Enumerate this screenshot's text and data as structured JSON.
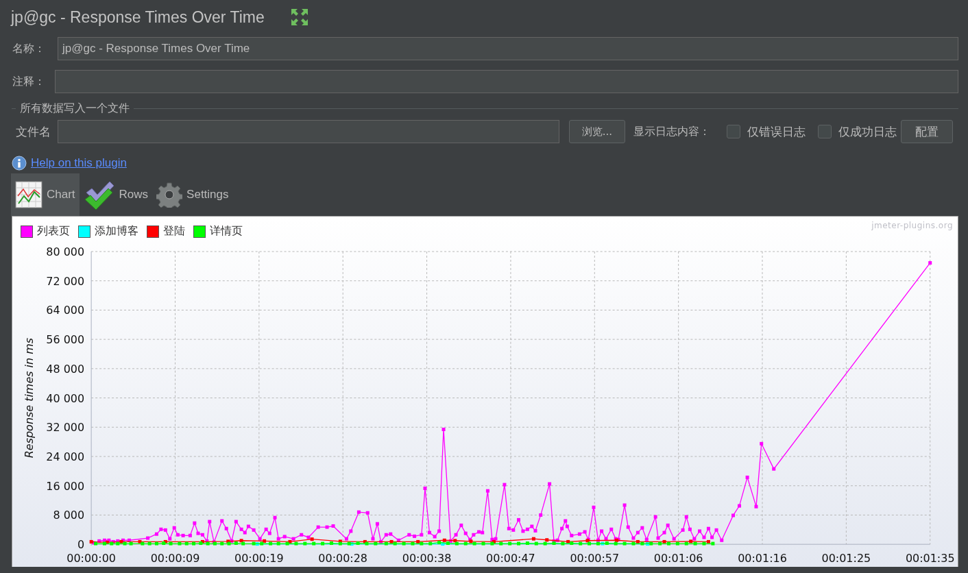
{
  "window": {
    "title": "jp@gc - Response Times Over Time"
  },
  "name_field": {
    "label": "名称：",
    "value": "jp@gc - Response Times Over Time"
  },
  "comment_field": {
    "label": "注释："
  },
  "file_section": {
    "title": "所有数据写入一个文件",
    "file_label": "文件名",
    "browse_button": "浏览...",
    "log_label": "显示日志内容：",
    "checkboxes": [
      {
        "label": "仅错误日志",
        "checked": false
      },
      {
        "label": "仅成功日志",
        "checked": false
      }
    ],
    "config_button": "配置"
  },
  "help_link": "Help on this plugin",
  "tabs": [
    {
      "label": "Chart",
      "kind": "chart",
      "selected": true
    },
    {
      "label": "Rows",
      "kind": "rows",
      "selected": false
    },
    {
      "label": "Settings",
      "kind": "settings",
      "selected": false
    }
  ],
  "chart": {
    "credit": "jmeter-plugins.org",
    "chart_data": {
      "type": "line",
      "grid": true,
      "ylabel": "Response times in ms",
      "xlim": [
        0,
        95
      ],
      "ylim": [
        0,
        80000
      ],
      "xticks": [
        {
          "value": 0,
          "label": "00:00:00"
        },
        {
          "value": 9.5,
          "label": "00:00:09"
        },
        {
          "value": 19,
          "label": "00:00:19"
        },
        {
          "value": 28.5,
          "label": "00:00:28"
        },
        {
          "value": 38,
          "label": "00:00:38"
        },
        {
          "value": 47.5,
          "label": "00:00:47"
        },
        {
          "value": 57,
          "label": "00:00:57"
        },
        {
          "value": 66.5,
          "label": "00:01:06"
        },
        {
          "value": 76,
          "label": "00:01:16"
        },
        {
          "value": 85.5,
          "label": "00:01:25"
        },
        {
          "value": 95,
          "label": "00:01:35"
        }
      ],
      "yticks": [
        {
          "value": 0,
          "label": "0"
        },
        {
          "value": 8000,
          "label": "8 000"
        },
        {
          "value": 16000,
          "label": "16 000"
        },
        {
          "value": 24000,
          "label": "24 000"
        },
        {
          "value": 32000,
          "label": "32 000"
        },
        {
          "value": 40000,
          "label": "40 000"
        },
        {
          "value": 48000,
          "label": "48 000"
        },
        {
          "value": 56000,
          "label": "56 000"
        },
        {
          "value": 64000,
          "label": "64 000"
        },
        {
          "value": 72000,
          "label": "72 000"
        },
        {
          "value": 80000,
          "label": "80 000"
        }
      ],
      "series": [
        {
          "name": "列表页",
          "color": "#ff00ff",
          "marker": "square",
          "x": [
            0.3,
            0.9,
            1.5,
            2.0,
            2.5,
            3.0,
            3.6,
            4.3,
            6.4,
            7.4,
            7.9,
            8.4,
            8.9,
            9.4,
            9.8,
            10.4,
            11.2,
            11.7,
            12.1,
            12.6,
            13.1,
            13.4,
            13.9,
            14.8,
            15.3,
            15.9,
            16.4,
            17.0,
            17.4,
            17.8,
            18.4,
            19.1,
            19.8,
            20.2,
            20.8,
            21.2,
            21.9,
            22.9,
            23.8,
            24.6,
            25.7,
            26.7,
            27.4,
            28.9,
            29.4,
            30.3,
            31.3,
            31.9,
            32.4,
            32.8,
            33.4,
            33.9,
            34.8,
            36.0,
            36.6,
            37.4,
            37.8,
            38.3,
            38.9,
            39.4,
            39.9,
            40.7,
            41.3,
            41.9,
            42.4,
            42.9,
            43.3,
            43.9,
            44.3,
            44.9,
            45.4,
            45.8,
            46.8,
            47.3,
            47.8,
            48.4,
            48.9,
            49.4,
            49.9,
            50.3,
            50.9,
            51.9,
            52.4,
            52.8,
            53.3,
            53.7,
            53.9,
            54.4,
            55.3,
            55.9,
            56.3,
            56.9,
            57.4,
            57.8,
            58.3,
            58.9,
            59.4,
            59.7,
            60.4,
            60.8,
            61.4,
            61.9,
            62.4,
            62.9,
            63.9,
            64.2,
            64.9,
            65.3,
            66.0,
            67.0,
            67.4,
            67.8,
            68.3,
            68.9,
            69.4,
            69.9,
            70.3,
            70.8,
            71.4,
            72.7,
            73.4,
            74.3,
            75.3,
            75.9,
            77.3,
            95.0
          ],
          "values": [
            400,
            900,
            1100,
            1100,
            700,
            900,
            1100,
            1100,
            1700,
            2800,
            4100,
            3900,
            1500,
            4500,
            2600,
            2400,
            2400,
            5800,
            3000,
            2600,
            900,
            6200,
            600,
            6400,
            4300,
            900,
            6200,
            4100,
            3200,
            4900,
            3900,
            1500,
            4100,
            3000,
            7300,
            1500,
            2100,
            1500,
            2600,
            1900,
            4700,
            4700,
            5000,
            1500,
            3600,
            8800,
            8600,
            1500,
            5600,
            700,
            2600,
            2800,
            1100,
            2600,
            2200,
            2600,
            15300,
            3200,
            2100,
            3600,
            31400,
            900,
            2600,
            5200,
            3000,
            1300,
            2600,
            3400,
            3200,
            14600,
            1300,
            1500,
            16300,
            4300,
            3900,
            6700,
            3600,
            4100,
            4900,
            3700,
            8000,
            16500,
            900,
            1100,
            4300,
            6400,
            4900,
            2400,
            2800,
            3400,
            1300,
            10100,
            1100,
            3600,
            1500,
            4100,
            1500,
            1300,
            10700,
            4700,
            1700,
            3200,
            4500,
            1300,
            7500,
            1700,
            3200,
            5200,
            1500,
            3900,
            7500,
            4100,
            1500,
            3600,
            1900,
            4300,
            1900,
            3900,
            1100,
            7900,
            10500,
            18300,
            10300,
            27500,
            20600,
            76900
          ]
        },
        {
          "name": "添加博客",
          "color": "#00ffff",
          "marker": "square",
          "x": [
            18.8,
            29.5,
            39.8,
            57.9,
            63.0
          ],
          "values": [
            100,
            100,
            100,
            200,
            100
          ]
        },
        {
          "name": "登陆",
          "color": "#ff0000",
          "marker": "square",
          "x": [
            0.0,
            1.8,
            3.4,
            5.5,
            8.4,
            12.6,
            15.5,
            17.0,
            19.6,
            22.5,
            25.0,
            28.2,
            31.0,
            34.0,
            37.0,
            40.0,
            41.2,
            43.0,
            45.6,
            50.1,
            51.6,
            54.0,
            56.2,
            59.5,
            61.9,
            64.9,
            67.9,
            69.9
          ],
          "values": [
            700,
            500,
            700,
            700,
            700,
            700,
            800,
            1000,
            900,
            700,
            1400,
            800,
            700,
            700,
            700,
            1100,
            1000,
            800,
            700,
            1500,
            1200,
            700,
            1000,
            1100,
            700,
            700,
            800,
            700
          ]
        },
        {
          "name": "详情页",
          "color": "#00ff00",
          "marker": "square",
          "x": [
            0.5,
            1.5,
            2.3,
            3.0,
            3.8,
            4.5,
            5.8,
            6.6,
            7.4,
            8.2,
            9.0,
            10.0,
            10.8,
            11.6,
            12.4,
            13.2,
            14.0,
            14.8,
            15.6,
            16.4,
            17.2,
            18.4,
            19.3,
            20.3,
            21.2,
            22.2,
            23.2,
            24.2,
            25.2,
            26.2,
            27.2,
            28.2,
            29.2,
            30.2,
            31.2,
            32.2,
            33.4,
            34.4,
            35.4,
            36.4,
            37.4,
            38.4,
            39.4,
            40.4,
            41.4,
            42.4,
            43.4,
            44.4,
            45.4,
            46.4,
            47.4,
            48.4,
            49.4,
            50.4,
            51.4,
            52.4,
            53.4,
            54.4,
            55.4,
            56.4,
            57.4,
            58.4,
            59.4,
            60.4,
            61.4,
            62.4,
            63.4,
            64.4,
            65.4,
            66.4,
            67.4,
            68.4,
            69.4,
            70.4
          ],
          "values": [
            200,
            200,
            200,
            200,
            200,
            200,
            200,
            200,
            200,
            300,
            200,
            200,
            200,
            200,
            300,
            200,
            200,
            200,
            200,
            300,
            200,
            200,
            200,
            200,
            200,
            200,
            200,
            200,
            200,
            200,
            300,
            200,
            200,
            300,
            200,
            200,
            200,
            200,
            200,
            200,
            200,
            200,
            500,
            300,
            200,
            200,
            200,
            200,
            200,
            200,
            200,
            200,
            300,
            200,
            200,
            300,
            200,
            300,
            200,
            200,
            200,
            300,
            200,
            200,
            200,
            200,
            200,
            200,
            200,
            200,
            200,
            200,
            200,
            200
          ]
        }
      ]
    }
  }
}
